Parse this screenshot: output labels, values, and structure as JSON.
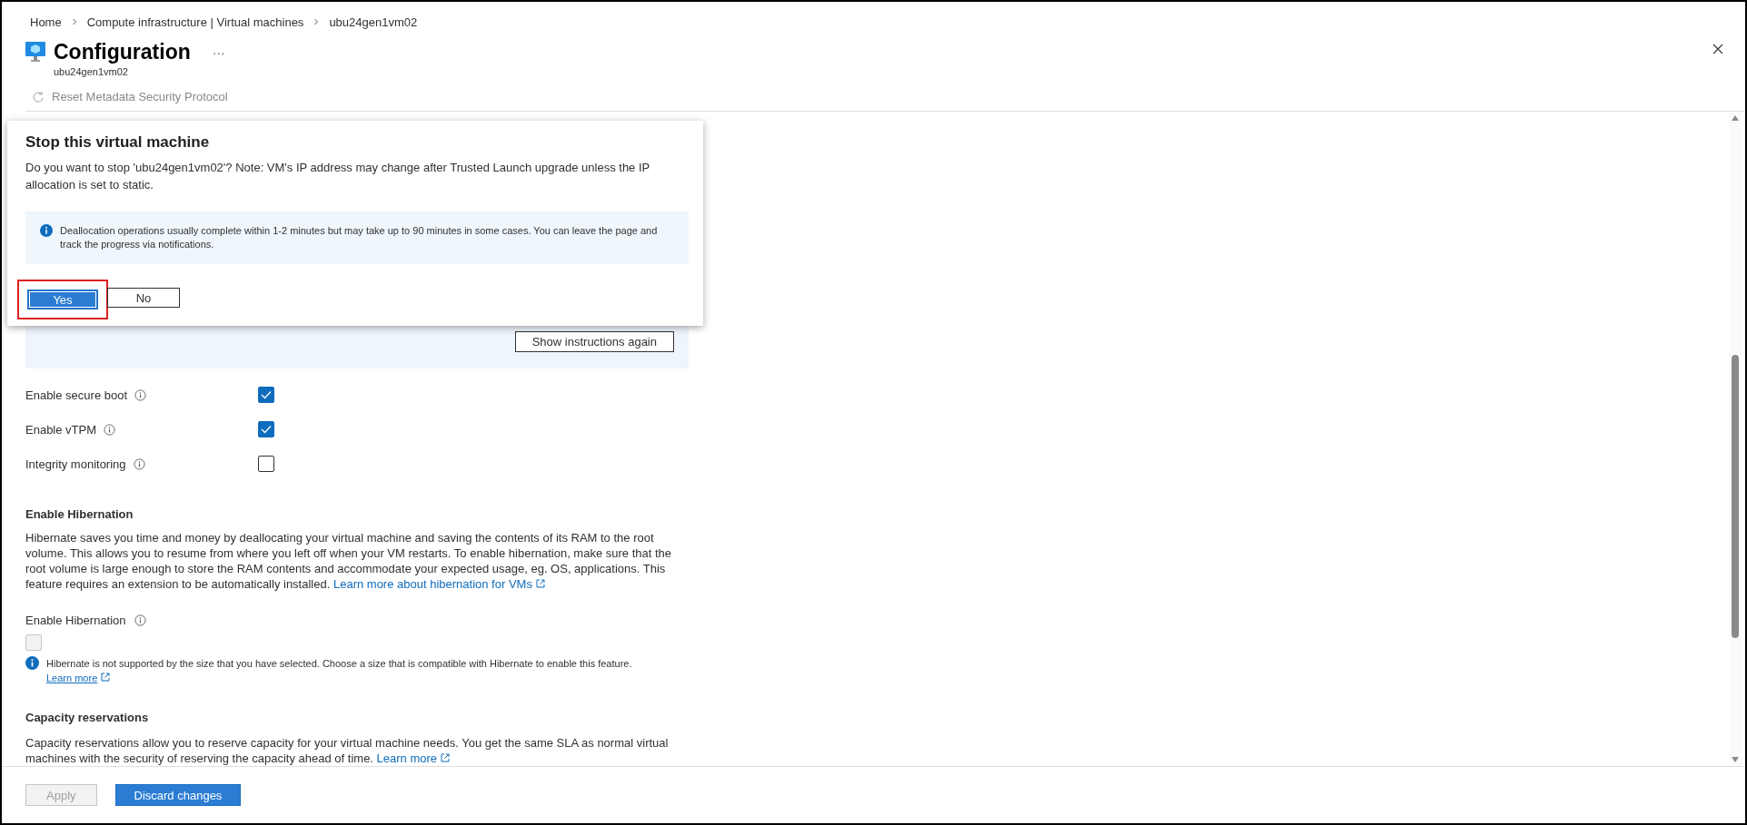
{
  "breadcrumb": [
    {
      "label": "Home"
    },
    {
      "label": "Compute infrastructure | Virtual machines"
    },
    {
      "label": "ubu24gen1vm02"
    }
  ],
  "header": {
    "title": "Configuration",
    "more": "···",
    "subtitle": "ubu24gen1vm02"
  },
  "toolbar": [
    {
      "label": "Reset Metadata Security Protocol",
      "disabled": true
    }
  ],
  "instructions_panel": {
    "button": "Show instructions again"
  },
  "security_options": [
    {
      "label": "Enable secure boot",
      "checked": true
    },
    {
      "label": "Enable vTPM",
      "checked": true
    },
    {
      "label": "Integrity monitoring",
      "checked": false
    }
  ],
  "hibernation": {
    "heading": "Enable Hibernation",
    "description": "Hibernate saves you time and money by deallocating your virtual machine and saving the contents of its RAM to the root volume. This allows you to resume from where you left off when your VM restarts. To enable hibernation, make sure that the root volume is large enough to store the RAM contents and accommodate your expected usage, eg. OS, applications. This feature requires an extension to be automatically installed.",
    "link": "Learn more about hibernation for VMs",
    "field_label": "Enable Hibernation",
    "checked": false,
    "disabled": true,
    "notice": "Hibernate is not supported by the size that you have selected. Choose a size that is compatible with Hibernate to enable this feature.",
    "notice_link": "Learn more"
  },
  "capacity": {
    "heading": "Capacity reservations",
    "description": "Capacity reservations allow you to reserve capacity for your virtual machine needs. You get the same SLA as normal virtual machines with the security of reserving the capacity ahead of time.",
    "link": "Learn more"
  },
  "footer": [
    {
      "label": "Apply",
      "kind": "secondary",
      "disabled": true
    },
    {
      "label": "Discard changes",
      "kind": "primary",
      "disabled": false
    }
  ],
  "dialog": {
    "title": "Stop this virtual machine",
    "message": "Do you want to stop 'ubu24gen1vm02'? Note: VM's IP address may change after Trusted Launch upgrade unless the IP allocation is set to static.",
    "info": "Deallocation operations usually complete within 1-2 minutes but may take up to 90 minutes in some cases. You can leave the page and track the progress via notifications.",
    "buttons": [
      {
        "label": "Yes",
        "kind": "primary",
        "highlighted": true
      },
      {
        "label": "No",
        "kind": "secondary",
        "highlighted": false
      }
    ]
  }
}
